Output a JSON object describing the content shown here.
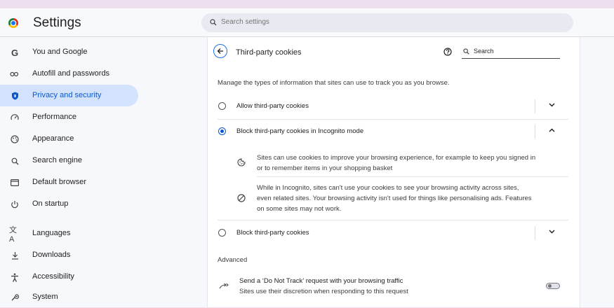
{
  "header": {
    "app_title": "Settings",
    "search_placeholder": "Search settings"
  },
  "sidebar": {
    "items": [
      {
        "label": "You and Google",
        "icon": "google-g-icon",
        "active": false
      },
      {
        "label": "Autofill and passwords",
        "icon": "key-icon",
        "active": false
      },
      {
        "label": "Privacy and security",
        "icon": "shield-icon",
        "active": true
      },
      {
        "label": "Performance",
        "icon": "speedometer-icon",
        "active": false
      },
      {
        "label": "Appearance",
        "icon": "palette-icon",
        "active": false
      },
      {
        "label": "Search engine",
        "icon": "search-icon",
        "active": false
      },
      {
        "label": "Default browser",
        "icon": "browser-window-icon",
        "active": false
      },
      {
        "label": "On startup",
        "icon": "power-icon",
        "active": false
      },
      {
        "label": "Languages",
        "icon": "translate-icon",
        "active": false
      },
      {
        "label": "Downloads",
        "icon": "download-icon",
        "active": false
      },
      {
        "label": "Accessibility",
        "icon": "accessibility-icon",
        "active": false
      },
      {
        "label": "System",
        "icon": "wrench-icon",
        "active": false
      }
    ]
  },
  "page": {
    "title": "Third-party cookies",
    "search_label": "Search",
    "description": "Manage the types of information that sites can use to track you as you browse.",
    "options": [
      {
        "label": "Allow third-party cookies",
        "selected": false,
        "expanded": false
      },
      {
        "label": "Block third-party cookies in Incognito mode",
        "selected": true,
        "expanded": true
      },
      {
        "label": "Block third-party cookies",
        "selected": false,
        "expanded": false
      }
    ],
    "details": [
      {
        "icon": "cookie-icon",
        "lines": [
          "Sites can use cookies to improve your browsing experience, for example to keep you signed in",
          "or to remember items in your shopping basket"
        ]
      },
      {
        "icon": "block-icon",
        "lines": [
          "While in Incognito, sites can't use your cookies to see your browsing activity across sites,",
          "even related sites. Your browsing activity isn't used for things like personalising ads. Features",
          "on some sites may not work."
        ]
      }
    ],
    "advanced": {
      "heading": "Advanced",
      "dnt_title": "Send a ‘Do Not Track’ request with your browsing traffic",
      "dnt_subtitle": "Sites use their discretion when responding to this request",
      "dnt_enabled": false
    }
  },
  "colors": {
    "accent": "#0b57d0",
    "active_nav_bg": "#d3e3fd",
    "page_bg": "#eddfee"
  }
}
